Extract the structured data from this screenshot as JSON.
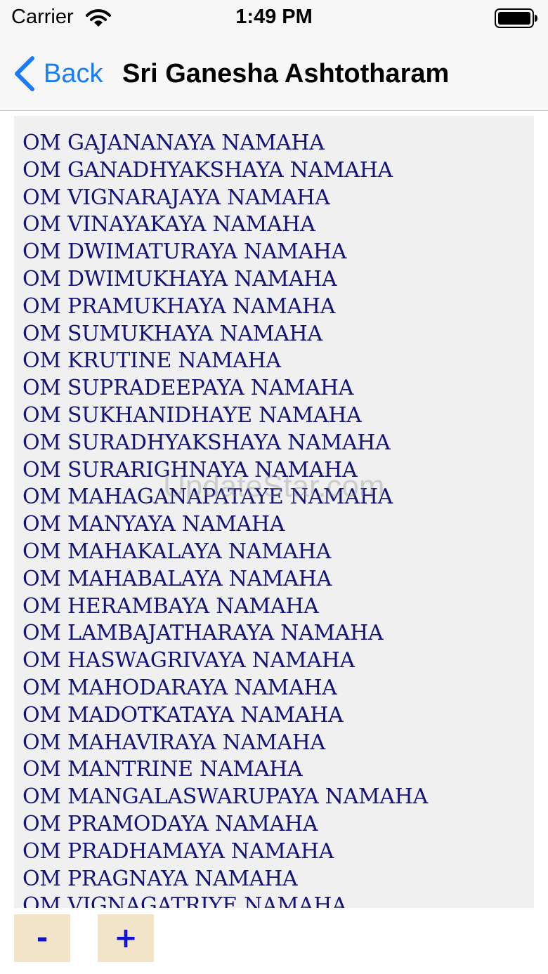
{
  "status_bar": {
    "carrier": "Carrier",
    "time": "1:49 PM",
    "wifi_icon": "wifi-icon",
    "battery_icon": "battery-icon"
  },
  "nav": {
    "back_label": "Back",
    "back_icon": "chevron-left-icon",
    "title": "Sri Ganesha Ashtotharam",
    "accent_color": "#1a7cf5"
  },
  "content": {
    "text_color": "#13137a",
    "background": "#f0f0f0",
    "mantras": [
      "OM GAJANANAYA NAMAHA",
      "OM GANADHYAKSHAYA NAMAHA",
      "OM VIGNARAJAYA NAMAHA",
      "OM VINAYAKAYA NAMAHA",
      "OM DWIMATURAYA NAMAHA",
      "OM DWIMUKHAYA NAMAHA",
      "OM PRAMUKHAYA NAMAHA",
      "OM SUMUKHAYA NAMAHA",
      "OM KRUTINE NAMAHA",
      "OM SUPRADEEPAYA NAMAHA",
      "OM SUKHANIDHAYE NAMAHA",
      "OM SURADHYAKSHAYA NAMAHA",
      "OM SURARIGHNAYA NAMAHA",
      "OM MAHAGANAPATAYE NAMAHA",
      "OM MANYAYA NAMAHA",
      "OM MAHAKALAYA NAMAHA",
      "OM MAHABALAYA NAMAHA",
      "OM HERAMBAYA NAMAHA",
      "OM LAMBAJATHARAYA NAMAHA",
      "OM HASWAGRIVAYA NAMAHA",
      "OM MAHODARAYA NAMAHA",
      "OM MADOTKATAYA NAMAHA",
      "OM MAHAVIRAYA NAMAHA",
      "OM MANTRINE NAMAHA",
      "OM MANGALASWARUPAYA NAMAHA",
      "OM PRAMODAYA NAMAHA",
      "OM PRADHAMAYA NAMAHA",
      "OM PRAGNAYA NAMAHA",
      "OM VIGNAGATRIYE NAMAHA"
    ]
  },
  "watermark": "UpdateStar.com",
  "controls": {
    "decrease_label": "-",
    "increase_label": "+",
    "button_color": "#f2e4c8",
    "label_color": "#1010d8"
  }
}
